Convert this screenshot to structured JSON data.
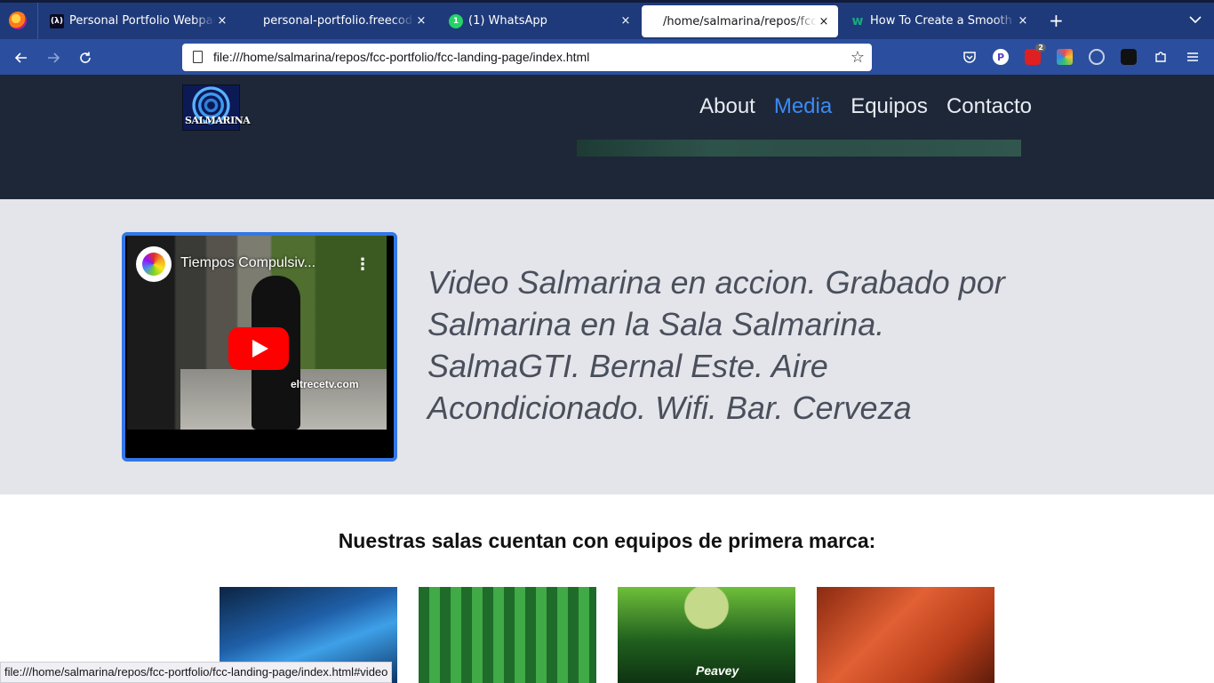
{
  "browser": {
    "tabs": [
      {
        "label": "Personal Portfolio Webpag",
        "icon": "freecodecamp-icon"
      },
      {
        "label": "personal-portfolio.freecodecar",
        "icon": "none"
      },
      {
        "label": "(1) WhatsApp",
        "icon": "whatsapp-icon"
      },
      {
        "label": "/home/salmarina/repos/fcc-pc",
        "icon": "none"
      },
      {
        "label": "How To Create a Smooth S",
        "icon": "wikihow-icon"
      }
    ],
    "tab_close": "×",
    "new_tab": "+",
    "url": "file:///home/salmarina/repos/fcc-portfolio/fcc-landing-page/index.html",
    "ext_badge": "2",
    "proton_letter": "P"
  },
  "site": {
    "logo_text": "SALMARINA",
    "nav": [
      "About",
      "Media",
      "Equipos",
      "Contacto"
    ],
    "video": {
      "title": "Tiempos Compulsiv...",
      "watermark": "eltrecetv.com"
    },
    "video_description": "Video Salmarina en accion. Grabado por Salmarina en la Sala Salmarina. SalmaGTI. Bernal Este. Aire Acondicionado. Wifi. Bar. Cerveza",
    "equipment_heading": "Nuestras salas cuentan con equipos de primera marca:",
    "amp_brand": "Peavey"
  },
  "status_bar": "file:///home/salmarina/repos/fcc-portfolio/fcc-landing-page/index.html#video",
  "colors": {
    "tabbar": "#1f3a7a",
    "navbar": "#2b4f9e",
    "header": "#1e2738",
    "accent": "#3a8bf5",
    "video_border": "#3277e6"
  }
}
